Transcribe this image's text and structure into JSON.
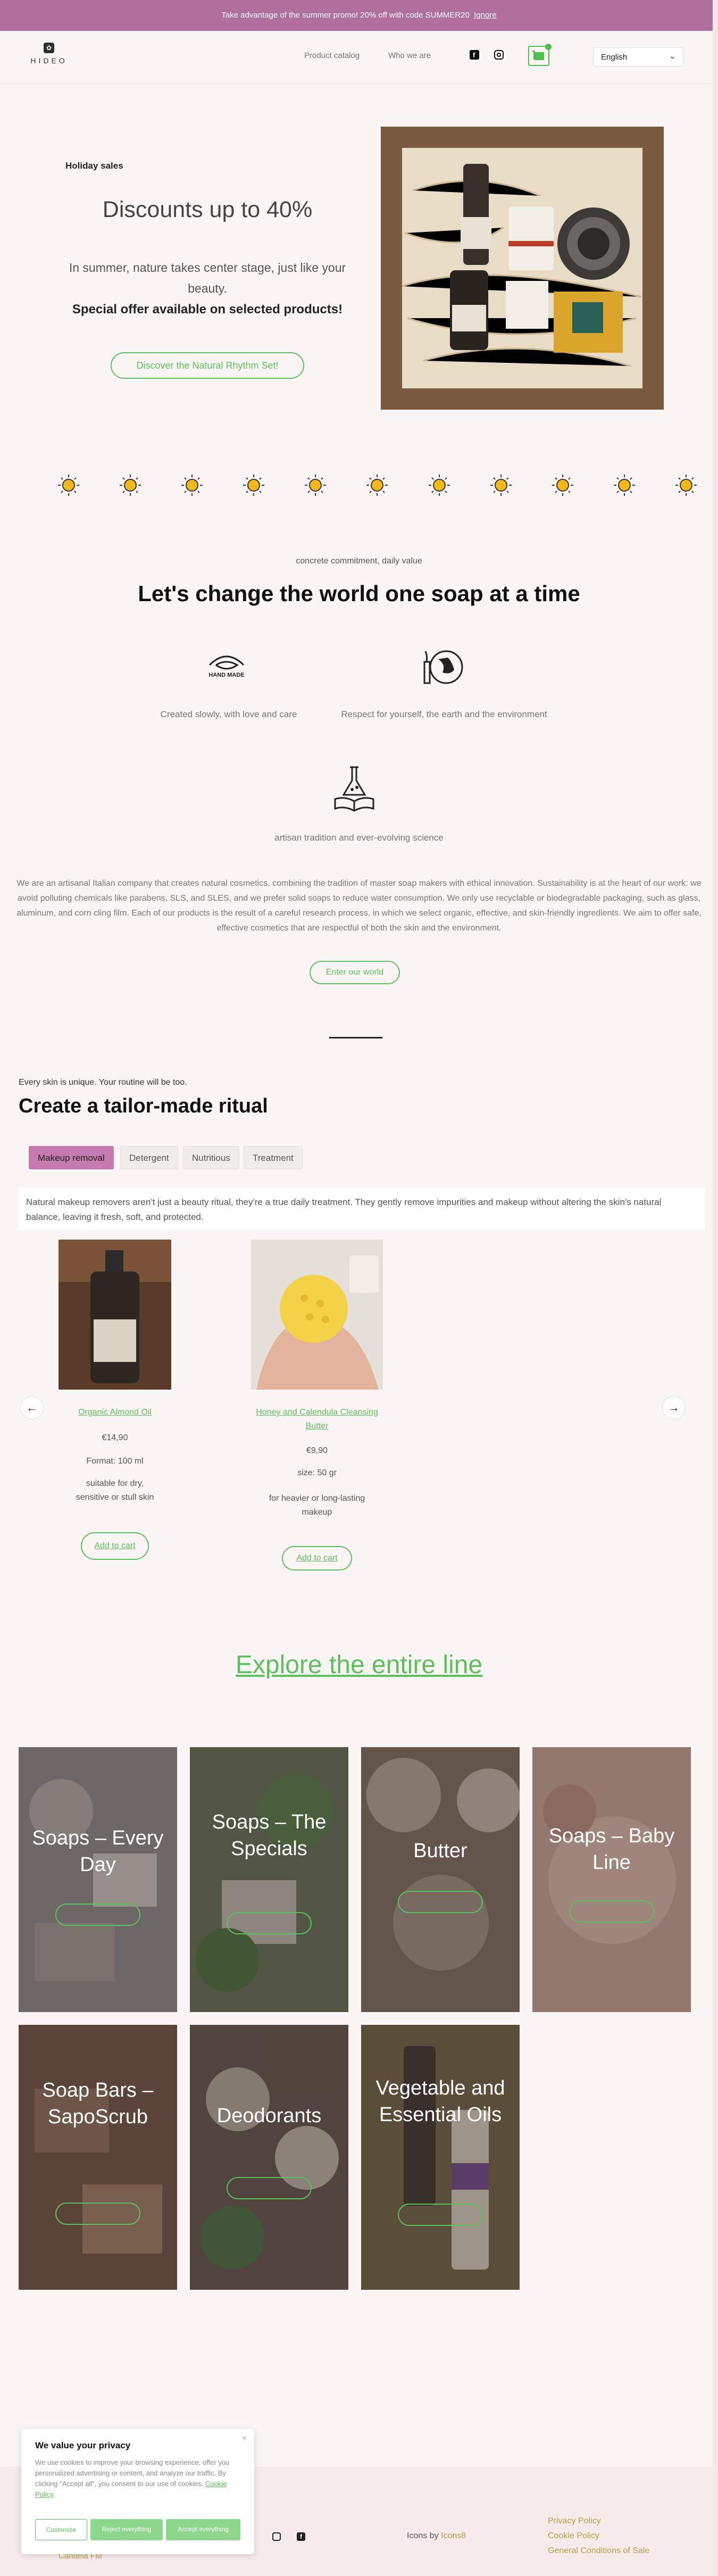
{
  "promo": {
    "text": "Take advantage of the summer promo! 20% off with code SUMMER20",
    "link": "Ignore"
  },
  "header": {
    "logo_word": "HIDEO",
    "nav": [
      "Product catalog",
      "Who we are"
    ],
    "language": "English"
  },
  "hero": {
    "kicker": "Holiday sales",
    "title": "Discounts up to 40%",
    "subtitle": "In summer, nature takes center stage, just like your beauty.",
    "bold": "Special offer available on selected products!",
    "button": "Discover the Natural Rhythm Set!"
  },
  "mission": {
    "kicker": "concrete commitment, daily value",
    "title": "Let's change the world one soap at a time",
    "features": [
      {
        "label": "Created slowly, with love and care",
        "icon": "handmade-icon"
      },
      {
        "label": "Respect for yourself, the earth and the environment",
        "icon": "earth-icon"
      },
      {
        "label": "artisan tradition and ever-evolving science",
        "icon": "flask-book-icon"
      }
    ],
    "about": "We are an artisanal Italian company that creates natural cosmetics, combining the tradition of master soap makers with ethical innovation. Sustainability is at the heart of our work: we avoid polluting chemicals like parabens, SLS, and SLES, and we prefer solid soaps to reduce water consumption. We only use recyclable or biodegradable packaging, such as glass, aluminum, and corn cling film. Each of our products is the result of a careful research process, in which we select organic, effective, and skin-friendly ingredients. We aim to offer safe, effective cosmetics that are respectful of both the skin and the environment.",
    "button": "Enter our world"
  },
  "ritual": {
    "kicker": "Every skin is unique. Your routine will be too.",
    "title": "Create a tailor-made ritual",
    "tabs": [
      "Makeup removal",
      "Detergent",
      "Nutritious",
      "Treatment"
    ],
    "description": "Natural makeup removers aren't just a beauty ritual, they're a true daily treatment. They gently remove impurities and makeup without altering the skin's natural balance, leaving it fresh, soft, and protected.",
    "products": [
      {
        "name": "Organic Almond Oil",
        "price": "€14,90",
        "size": "Format: 100 ml",
        "note": "suitable for dry, sensitive or stull skin",
        "button": "Add to cart"
      },
      {
        "name": "Honey and Calendula Cleansing Butter",
        "price": "€9,90",
        "size": "size: 50 gr",
        "note": "for heavier or long-lasting makeup",
        "button": "Add to cart"
      }
    ]
  },
  "explore": "Explore the entire line",
  "categories": [
    {
      "title": "Soaps – Every Day"
    },
    {
      "title": "Soaps – The Specials"
    },
    {
      "title": "Butter"
    },
    {
      "title": "Soaps – Baby Line"
    },
    {
      "title": "Soap Bars – SapoScrub"
    },
    {
      "title": "Deodorants"
    },
    {
      "title": "Vegetable and Essential Oils"
    }
  ],
  "cookie": {
    "title": "We value your privacy",
    "text": "We use cookies to improve your browsing experience, offer you personalized advertising or content, and analyze our traffic. By clicking \"Accept all\", you consent to our use of cookies.",
    "policy_link": "Cookie Policy",
    "buttons": [
      "Customize",
      "Reject everything",
      "Accept everything"
    ]
  },
  "footer": {
    "city": "Candela FM",
    "credits_label": "Icons by",
    "credits_link": "Icons8",
    "links": [
      "Privacy Policy",
      "Cookie Policy",
      "General Conditions of Sale"
    ]
  },
  "colors": {
    "accent_green": "#5cc15c",
    "promo_purple": "#b06f9c",
    "tab_active": "#c57ab0",
    "sun_yellow": "#f2b81c"
  }
}
